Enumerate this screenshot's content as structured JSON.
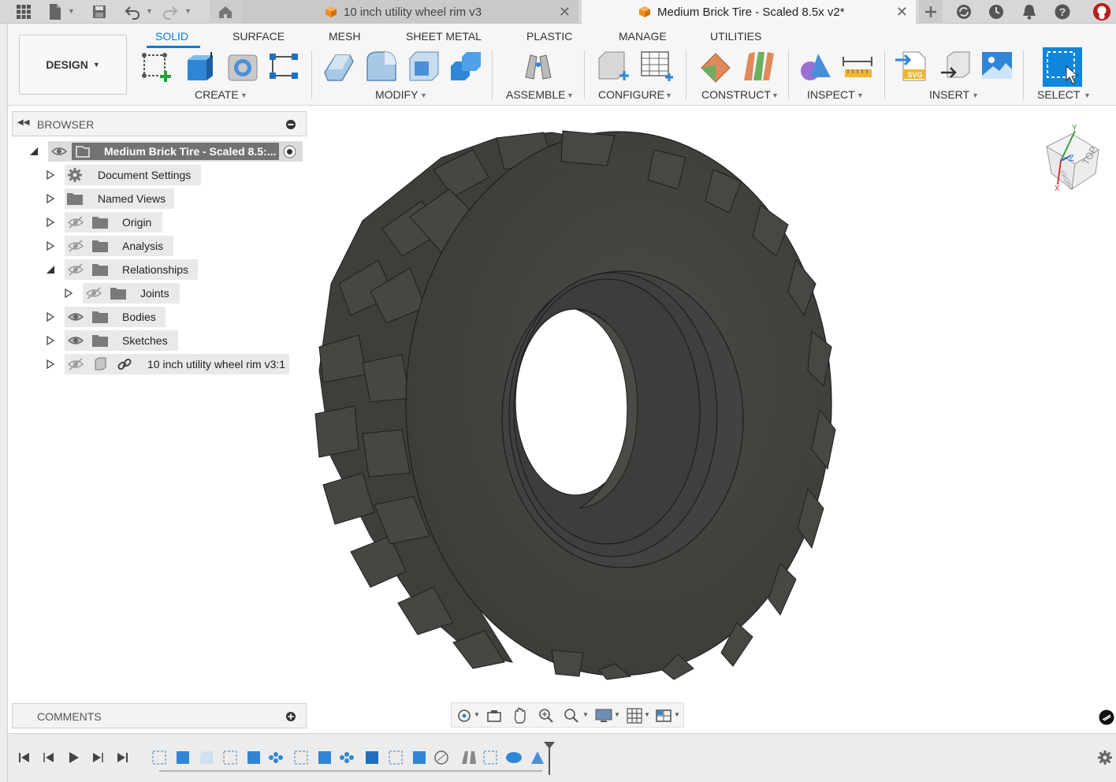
{
  "tabbar": {
    "tabs": [
      {
        "title": "10 inch utility wheel rim v3",
        "icon": "component-cube-icon",
        "close": "✕"
      },
      {
        "title": "Medium Brick Tire - Scaled 8.5x v2*",
        "icon": "component-cube-icon",
        "close": "✕",
        "active": true
      }
    ],
    "left_icons": [
      "app-grid-icon",
      "file-icon",
      "save-icon",
      "undo-icon",
      "redo-icon",
      "home-icon"
    ],
    "right_icons": [
      "new-tab-icon",
      "job-status-icon",
      "history-icon",
      "notification-bell-icon",
      "user-avatar-icon"
    ]
  },
  "toolbar": {
    "workspace": "DESIGN",
    "tabs": [
      "SOLID",
      "SURFACE",
      "MESH",
      "SHEET METAL",
      "PLASTIC",
      "MANAGE",
      "UTILITIES"
    ],
    "active_tab": "SOLID",
    "groups": [
      {
        "label": "CREATE",
        "tools": [
          "create-sketch-icon",
          "extrude-icon",
          "revolve-icon",
          "pattern-icon"
        ]
      },
      {
        "label": "MODIFY",
        "tools": [
          "press-pull-icon",
          "fillet-icon",
          "shell-icon",
          "combine-icon"
        ]
      },
      {
        "label": "ASSEMBLE",
        "tools": [
          "joint-icon"
        ]
      },
      {
        "label": "CONFIGURE",
        "tools": [
          "configure-model-icon",
          "configuration-table-icon"
        ]
      },
      {
        "label": "CONSTRUCT",
        "tools": [
          "offset-plane-icon",
          "midplane-icon"
        ]
      },
      {
        "label": "INSPECT",
        "tools": [
          "section-analysis-icon",
          "measure-icon"
        ]
      },
      {
        "label": "INSERT",
        "tools": [
          "insert-svg-icon",
          "insert-derive-icon",
          "canvas-icon"
        ]
      },
      {
        "label": "SELECT",
        "tools": [
          "select-window-icon"
        ]
      }
    ],
    "accent": "#0a7ad6"
  },
  "browser": {
    "title": "BROWSER",
    "root": "Medium Brick Tire - Scaled 8.5:...",
    "items": [
      {
        "label": "Document Settings",
        "icon": "gear-icon"
      },
      {
        "label": "Named Views",
        "icon": "folder-icon"
      },
      {
        "label": "Origin",
        "icon": "folder-icon",
        "eye": "hidden"
      },
      {
        "label": "Analysis",
        "icon": "folder-icon",
        "eye": "hidden"
      },
      {
        "label": "Relationships",
        "icon": "folder-icon",
        "eye": "hidden",
        "expanded": true
      },
      {
        "label": "Joints",
        "icon": "folder-icon",
        "eye": "hidden"
      },
      {
        "label": "Bodies",
        "icon": "folder-icon",
        "eye": "visible"
      },
      {
        "label": "Sketches",
        "icon": "folder-icon",
        "eye": "visible"
      },
      {
        "label": "10 inch utility wheel rim v3:1",
        "icon": "linked-component-icon",
        "eye": "hidden"
      }
    ]
  },
  "comments": {
    "title": "COMMENTS"
  },
  "viewcube": {
    "faces": [
      "TOP",
      "FRONT"
    ],
    "axes": [
      "X",
      "Y",
      "Z"
    ]
  },
  "navbar": {
    "icons": [
      "orbit-icon",
      "look-at-icon",
      "pan-icon",
      "zoom-icon",
      "zoom-window-icon",
      "display-settings-icon",
      "grid-icon",
      "viewports-icon"
    ]
  },
  "timeline": {
    "controls": [
      "go-to-start-icon",
      "step-back-icon",
      "play-icon",
      "step-forward-icon",
      "go-to-end-icon"
    ],
    "features": [
      "sketch",
      "extrude",
      "fillet",
      "sketch",
      "extrude",
      "pattern",
      "sketch",
      "extrude",
      "pattern",
      "box",
      "sketch",
      "extrude",
      "combine",
      "joint",
      "sketch",
      "revolve",
      "section"
    ]
  }
}
